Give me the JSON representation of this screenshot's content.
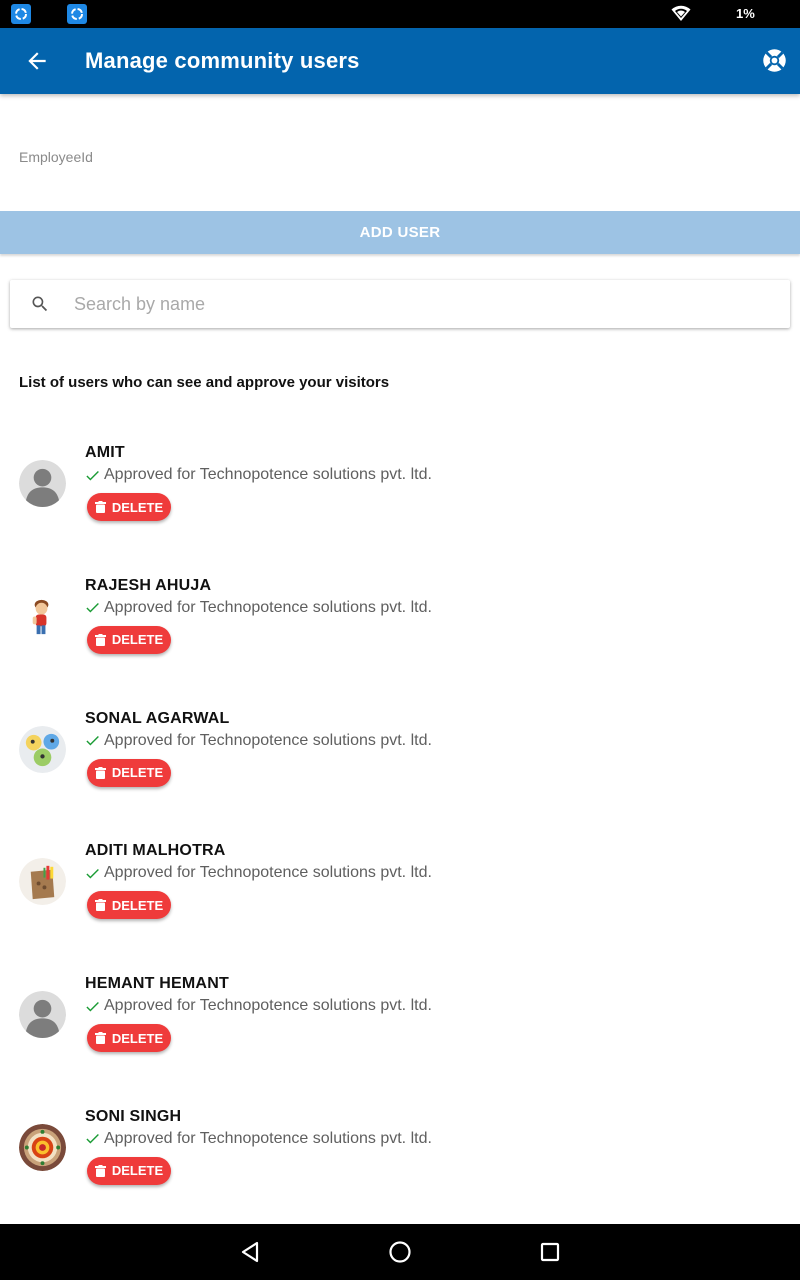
{
  "status_bar": {
    "battery_text": "1%",
    "icons": [
      "app-notification-icon",
      "app-notification-icon",
      "wifi-icon"
    ]
  },
  "app_bar": {
    "title": "Manage community users",
    "back_icon": "arrow-back-icon",
    "help_icon": "lifebuoy-help-icon",
    "color": "#0364ad"
  },
  "form": {
    "employee_label": "EmployeeId",
    "employee_value": "",
    "add_user_label": "ADD USER"
  },
  "search": {
    "placeholder": "Search by name",
    "value": ""
  },
  "list_heading": "List of users who can see and approve your visitors",
  "users": [
    {
      "name": "AMIT",
      "status": "Approved for Technopotence solutions pvt. ltd.",
      "avatar": "default-person",
      "delete_label": "DELETE"
    },
    {
      "name": "RAJESH AHUJA",
      "status": "Approved for Technopotence solutions pvt. ltd.",
      "avatar": "cartoon-boy",
      "delete_label": "DELETE"
    },
    {
      "name": "SONAL AGARWAL",
      "status": "Approved for Technopotence solutions pvt. ltd.",
      "avatar": "colorful-blobs",
      "delete_label": "DELETE"
    },
    {
      "name": "ADITI MALHOTRA",
      "status": "Approved for Technopotence solutions pvt. ltd.",
      "avatar": "craft-bag",
      "delete_label": "DELETE"
    },
    {
      "name": "HEMANT HEMANT",
      "status": "Approved for Technopotence solutions pvt. ltd.",
      "avatar": "default-person",
      "delete_label": "DELETE"
    },
    {
      "name": "SONI SINGH",
      "status": "Approved for Technopotence solutions pvt. ltd.",
      "avatar": "rangoli-plate",
      "delete_label": "DELETE"
    }
  ],
  "colors": {
    "delete": "#ef3b3b",
    "approved_check": "#1a9b34",
    "add_user_bg": "#9dc3e4"
  },
  "nav_bar": {
    "icons": [
      "back-triangle-icon",
      "home-circle-icon",
      "recents-square-icon"
    ]
  }
}
